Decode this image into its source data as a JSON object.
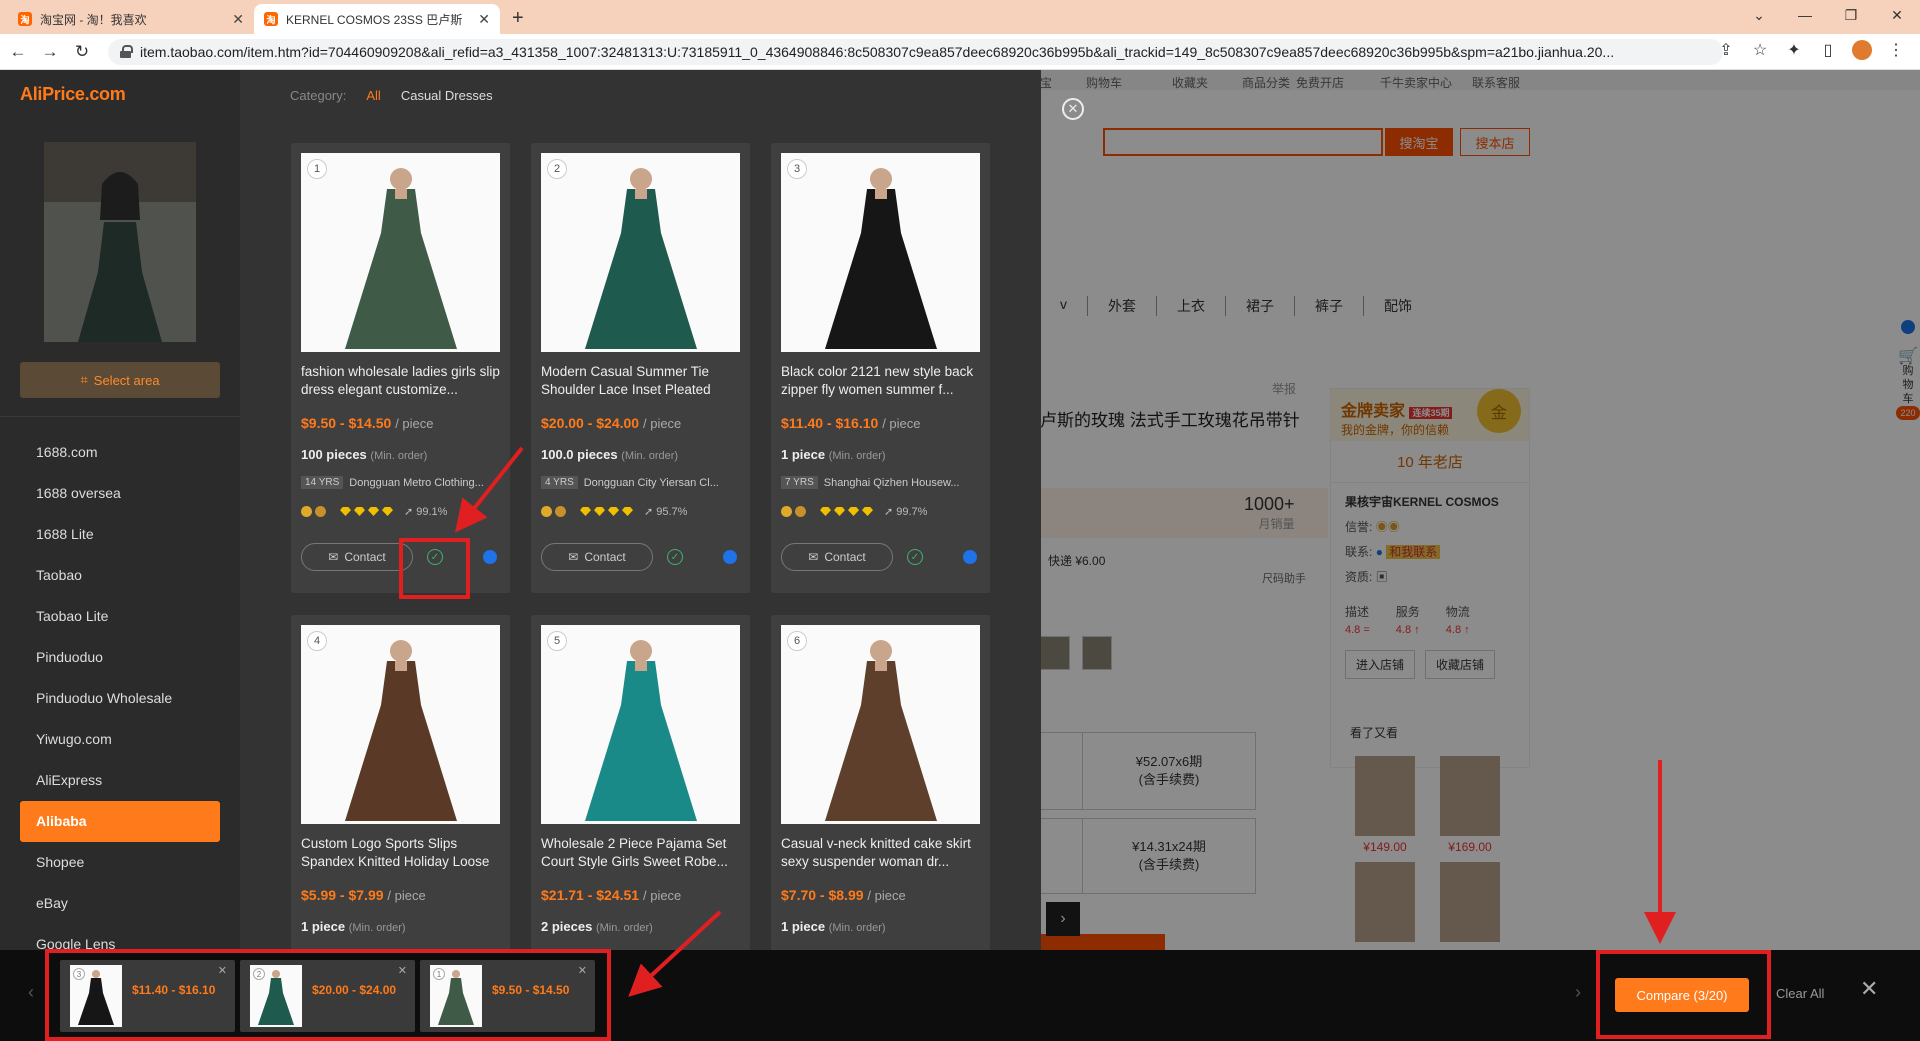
{
  "browser": {
    "tabs": [
      {
        "favicon": "淘",
        "title": "淘宝网 - 淘！我喜欢",
        "active": false
      },
      {
        "favicon": "淘",
        "title": "KERNEL COSMOS 23SS 巴卢斯",
        "active": true
      }
    ],
    "url": "item.taobao.com/item.htm?id=704460909208&ali_refid=a3_431358_1007:32481313:U:73185911_0_4364908846:8c508307c9ea857deec68920c36b995b&ali_trackid=149_8c508307c9ea857deec68920c36b995b&spm=a21bo.jianhua.20..."
  },
  "taobao": {
    "topbar": [
      "宝",
      "购物车",
      "收藏夹",
      "商品分类",
      "免费开店",
      "千牛卖家中心",
      "联系客服"
    ],
    "search_btn": "搜淘宝",
    "search_store_btn": "搜本店",
    "nav": [
      "v",
      "外套",
      "上衣",
      "裙子",
      "裤子",
      "配饰"
    ],
    "title": "卢斯的玫瑰 法式手工玫瑰花吊带针",
    "report": "举报",
    "monthly_sales": "1000+",
    "monthly_sales_label": "月销量",
    "shipping": "快递 ¥6.00",
    "size_helper": "尺码助手",
    "installment_1": "¥52.07x6期",
    "installment_1_sub": "(含手续费)",
    "installment_2": "¥14.31x24期",
    "installment_2_sub": "(含手续费)",
    "seller": {
      "gold_title": "金牌卖家",
      "gold_badge": "连续35期",
      "gold_sub": "我的金牌，你的信赖",
      "medal": "金",
      "years": "10 年老店",
      "name": "果核宇宙KERNEL COSMOS",
      "credit_label": "信誉:",
      "contact_label": "联系:",
      "contact_value": "和我联系",
      "qual_label": "资质:",
      "scores": [
        {
          "label": "描述",
          "value": "4.8 ="
        },
        {
          "label": "服务",
          "value": "4.8 ↑"
        },
        {
          "label": "物流",
          "value": "4.8 ↑"
        }
      ],
      "btn_store": "进入店铺",
      "btn_fav": "收藏店铺"
    },
    "seen_title": "看了又看",
    "seen_prices": [
      "¥149.00",
      "¥169.00"
    ],
    "rightbar": [
      "购",
      "物",
      "车",
      "220"
    ]
  },
  "aliprice": {
    "logo": "AliPrice.com",
    "select_area": "Select area",
    "menu": [
      "1688.com",
      "1688 oversea",
      "1688 Lite",
      "Taobao",
      "Taobao Lite",
      "Pinduoduo",
      "Pinduoduo Wholesale",
      "Yiwugo.com",
      "AliExpress",
      "Alibaba",
      "Shopee",
      "eBay",
      "Google Lens"
    ],
    "active_menu": "Alibaba",
    "category_label": "Category:",
    "category_all": "All",
    "category_casual": "Casual Dresses",
    "contact_label": "Contact",
    "per_piece": "/ piece",
    "min_order": "(Min. order)",
    "yrs": "YRS",
    "products": [
      {
        "num": "1",
        "title": "fashion wholesale ladies girls slip dress elegant customize...",
        "price": "$9.50 - $14.50",
        "moq": "100 pieces",
        "years": "14",
        "supplier": "Dongguan Metro Clothing...",
        "rating": "99.1%",
        "color": "#3f5a46"
      },
      {
        "num": "2",
        "title": "Modern Casual Summer Tie Shoulder Lace Inset Pleated Ch...",
        "price": "$20.00 - $24.00",
        "moq": "100.0 pieces",
        "years": "4",
        "supplier": "Dongguan City Yiersan Cl...",
        "rating": "95.7%",
        "color": "#1f5a4e"
      },
      {
        "num": "3",
        "title": "Black color 2121 new style back zipper fly women summer f...",
        "price": "$11.40 - $16.10",
        "moq": "1 piece",
        "years": "7",
        "supplier": "Shanghai Qizhen Housew...",
        "rating": "99.7%",
        "color": "#161616"
      },
      {
        "num": "4",
        "title": "Custom Logo Sports Slips Spandex Knitted Holiday Loose ...",
        "price": "$5.99 - $7.99",
        "moq": "1 piece",
        "color": "#5a3a26"
      },
      {
        "num": "5",
        "title": "Wholesale 2 Piece Pajama Set Court Style Girls Sweet Robe...",
        "price": "$21.71 - $24.51",
        "moq": "2 pieces",
        "color": "#1a8a88"
      },
      {
        "num": "6",
        "title": "Casual v-neck knitted cake skirt sexy suspender woman dr...",
        "price": "$7.70 - $8.99",
        "moq": "1 piece",
        "color": "#5e3f2c"
      }
    ],
    "tray": [
      {
        "num": "3",
        "price": "$11.40 - $16.10",
        "color": "#161616"
      },
      {
        "num": "2",
        "price": "$20.00 - $24.00",
        "color": "#1f5a4e"
      },
      {
        "num": "1",
        "price": "$9.50 - $14.50",
        "color": "#3f5a46"
      }
    ],
    "compare_btn": "Compare (3/20)",
    "clear_all": "Clear All"
  },
  "colors": {
    "accent": "#ff7a1a",
    "annotation": "#e02020",
    "taobao": "#ff5000"
  }
}
